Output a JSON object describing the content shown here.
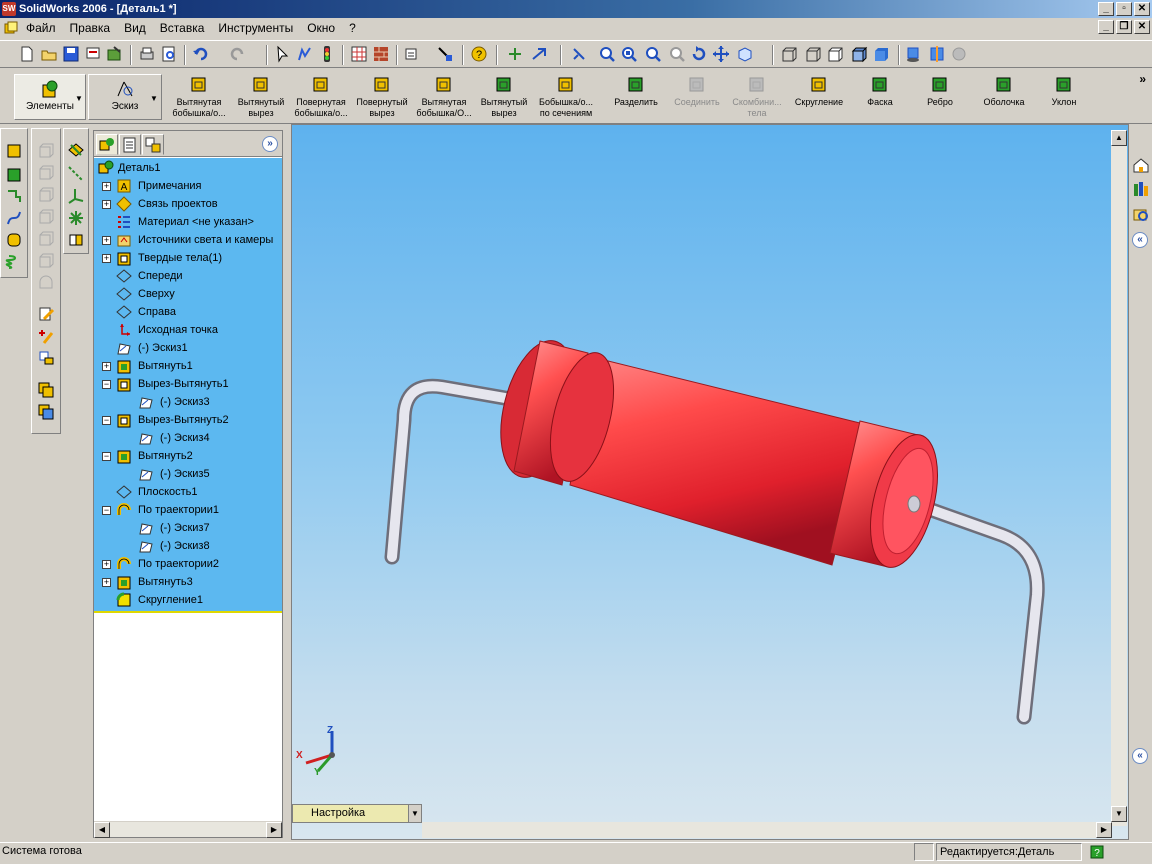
{
  "window": {
    "title": "SolidWorks 2006 - [Деталь1 *]",
    "app_icon_text": "SW"
  },
  "menu": {
    "items": [
      "Файл",
      "Правка",
      "Вид",
      "Вставка",
      "Инструменты",
      "Окно",
      "?"
    ]
  },
  "command_manager": {
    "tabs": [
      {
        "label": "Элементы"
      },
      {
        "label": "Эскиз"
      }
    ],
    "buttons": [
      {
        "label": "Вытянутая бобышка/о...",
        "icon": "extruded-boss-icon",
        "enabled": true
      },
      {
        "label": "Вытянутый вырез",
        "icon": "extruded-cut-icon",
        "enabled": true
      },
      {
        "label": "Повернутая бобышка/о...",
        "icon": "revolved-boss-icon",
        "enabled": true
      },
      {
        "label": "Повернутый вырез",
        "icon": "revolved-cut-icon",
        "enabled": true
      },
      {
        "label": "Вытянутая бобышка/О...",
        "icon": "swept-boss-icon",
        "enabled": true
      },
      {
        "label": "Вытянутый вырез",
        "icon": "swept-cut-icon",
        "enabled": true
      },
      {
        "label": "Бобышка/о... по сечениям",
        "icon": "lofted-boss-icon",
        "enabled": true
      },
      {
        "label": "Разделить",
        "icon": "split-icon",
        "enabled": true
      },
      {
        "label": "Соединить",
        "icon": "join-icon",
        "enabled": false
      },
      {
        "label": "Скомбини... тела",
        "icon": "combine-icon",
        "enabled": false
      },
      {
        "label": "Скругление",
        "icon": "fillet-icon",
        "enabled": true
      },
      {
        "label": "Фаска",
        "icon": "chamfer-icon",
        "enabled": true
      },
      {
        "label": "Ребро",
        "icon": "rib-icon",
        "enabled": true
      },
      {
        "label": "Оболочка",
        "icon": "shell-icon",
        "enabled": true
      },
      {
        "label": "Уклон",
        "icon": "draft-icon",
        "enabled": true
      }
    ],
    "more": "»"
  },
  "tree": {
    "root": "Деталь1",
    "items": [
      {
        "label": "Примечания",
        "exp": "+",
        "level": 1,
        "icon": "annotations-icon"
      },
      {
        "label": "Связь проектов",
        "exp": "+",
        "level": 1,
        "icon": "design-binder-icon"
      },
      {
        "label": "Материал <не указан>",
        "exp": "",
        "level": 1,
        "icon": "material-icon"
      },
      {
        "label": "Источники света и камеры",
        "exp": "+",
        "level": 1,
        "icon": "lights-icon"
      },
      {
        "label": "Твердые тела(1)",
        "exp": "+",
        "level": 1,
        "icon": "solid-bodies-icon"
      },
      {
        "label": "Спереди",
        "exp": "",
        "level": 1,
        "icon": "plane-icon"
      },
      {
        "label": "Сверху",
        "exp": "",
        "level": 1,
        "icon": "plane-icon"
      },
      {
        "label": "Справа",
        "exp": "",
        "level": 1,
        "icon": "plane-icon"
      },
      {
        "label": "Исходная точка",
        "exp": "",
        "level": 1,
        "icon": "origin-icon"
      },
      {
        "label": "(-) Эскиз1",
        "exp": "",
        "level": 1,
        "icon": "sketch-icon"
      },
      {
        "label": "Вытянуть1",
        "exp": "+",
        "level": 1,
        "icon": "extrude-icon"
      },
      {
        "label": "Вырез-Вытянуть1",
        "exp": "−",
        "level": 1,
        "icon": "cut-extrude-icon"
      },
      {
        "label": "(-) Эскиз3",
        "exp": "",
        "level": 2,
        "icon": "sketch-icon"
      },
      {
        "label": "Вырез-Вытянуть2",
        "exp": "−",
        "level": 1,
        "icon": "cut-extrude-icon"
      },
      {
        "label": "(-) Эскиз4",
        "exp": "",
        "level": 2,
        "icon": "sketch-icon"
      },
      {
        "label": "Вытянуть2",
        "exp": "−",
        "level": 1,
        "icon": "extrude-icon"
      },
      {
        "label": "(-) Эскиз5",
        "exp": "",
        "level": 2,
        "icon": "sketch-icon"
      },
      {
        "label": "Плоскость1",
        "exp": "",
        "level": 1,
        "icon": "plane-icon"
      },
      {
        "label": "По траектории1",
        "exp": "−",
        "level": 1,
        "icon": "sweep-icon"
      },
      {
        "label": "(-) Эскиз7",
        "exp": "",
        "level": 2,
        "icon": "sketch-icon"
      },
      {
        "label": "(-) Эскиз8",
        "exp": "",
        "level": 2,
        "icon": "sketch-icon"
      },
      {
        "label": "По траектории2",
        "exp": "+",
        "level": 1,
        "icon": "sweep-icon"
      },
      {
        "label": "Вытянуть3",
        "exp": "+",
        "level": 1,
        "icon": "extrude-icon"
      },
      {
        "label": "Скругление1",
        "exp": "",
        "level": 1,
        "icon": "fillet-icon"
      }
    ]
  },
  "viewport": {
    "triad": {
      "x": "X",
      "y": "Y",
      "z": "Z"
    },
    "config_label": "Настройка",
    "colors": {
      "body": "#ff4e4e",
      "body_dark": "#c81e2a",
      "lead": "#d8d8e0"
    }
  },
  "status": {
    "message": "Система готова",
    "editing": "Редактируется:Деталь"
  },
  "colors": {
    "tree_bg": "#5cb8f0",
    "viewport_top": "#5eb2ee",
    "viewport_bottom": "#d8e6ef",
    "titlebar": "#0a246a"
  }
}
